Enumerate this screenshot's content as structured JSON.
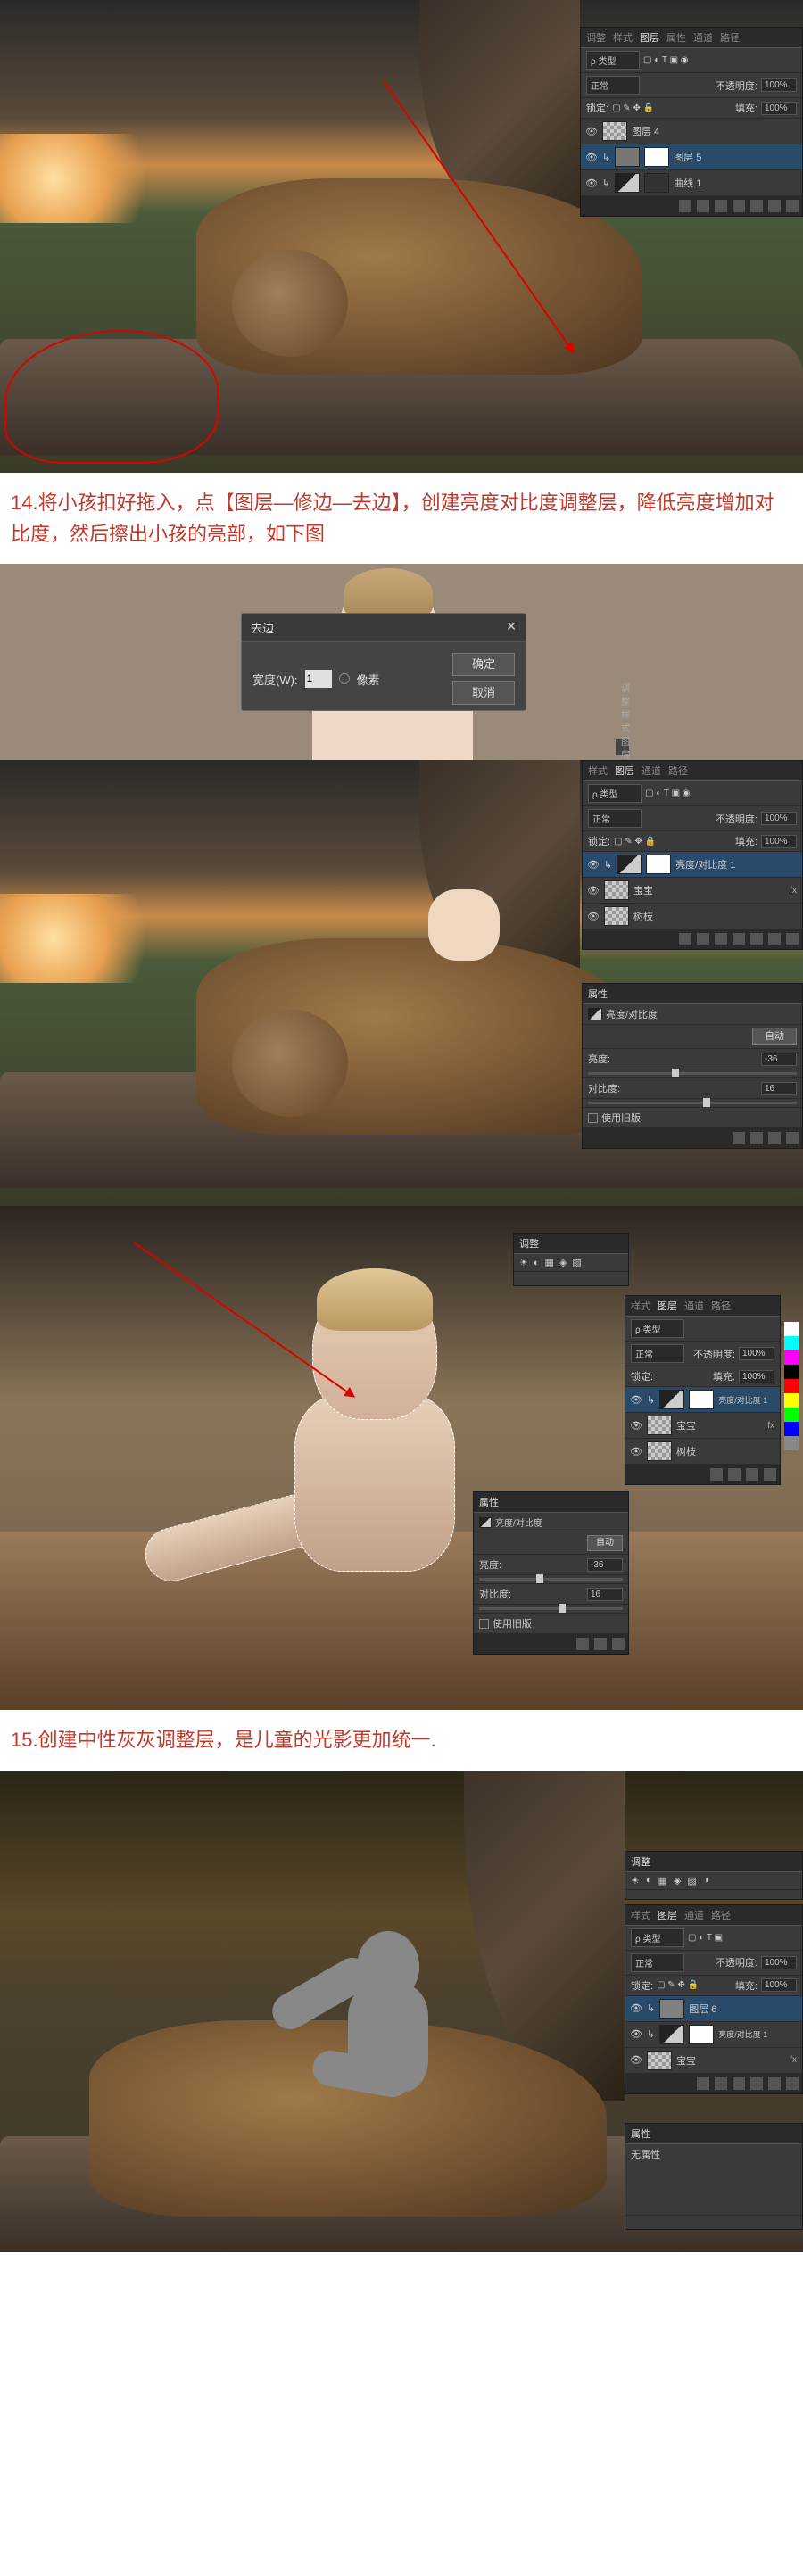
{
  "step14_text": "14.将小孩扣好拖入，点【图层—修边—去边】，创建亮度对比度调整层，降低亮度增加对比度，然后擦出小孩的亮部，如下图",
  "step15_text": "15.创建中性灰灰调整层，是儿童的光影更加统一.",
  "defringe_dialog": {
    "title": "去边",
    "width_label": "宽度(W):",
    "width_value": "1",
    "unit": "像素",
    "ok": "确定",
    "cancel": "取消"
  },
  "layers_panel": {
    "tabs": {
      "adjust": "调整",
      "style": "样式",
      "layers": "图层",
      "properties": "属性",
      "channels": "通道",
      "paths": "路径"
    },
    "kind_label": "ρ 类型",
    "blend_normal": "正常",
    "opacity_label": "不透明度:",
    "opacity_value": "100%",
    "lock_label": "锁定:",
    "fill_label": "填充:",
    "fill_value": "100%",
    "layer4": "图层 4",
    "layer5": "图层 5",
    "layer6": "图层 6",
    "curves1": "曲线 1",
    "brightness_contrast1": "亮度/对比度 1",
    "baby_layer": "宝宝",
    "branch_layer": "树枝",
    "fx": "fx"
  },
  "properties_panel": {
    "title": "属性",
    "bc_title": "亮度/对比度",
    "auto_btn": "自动",
    "brightness_label": "亮度:",
    "brightness_value": "-36",
    "contrast_label": "对比度:",
    "contrast_value": "16",
    "legacy_label": "使用旧版",
    "no_props": "无属性"
  },
  "child_strip_panel_tabs": "调整 样式 图层 通道 路径"
}
